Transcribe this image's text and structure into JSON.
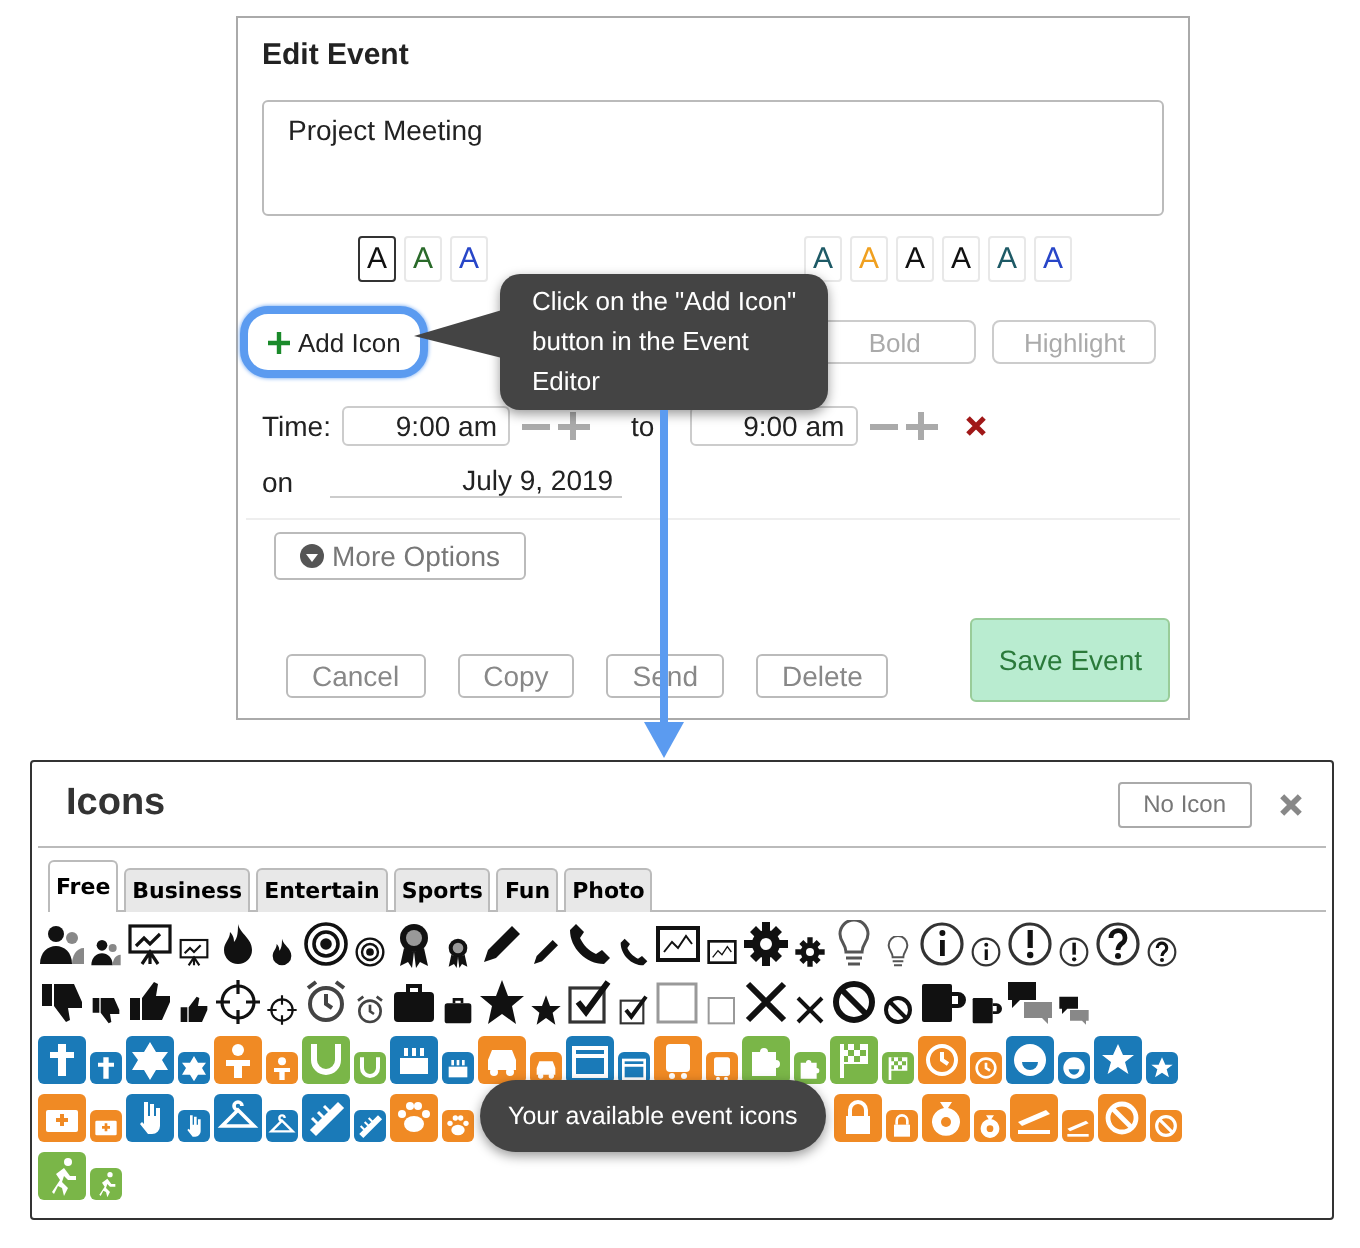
{
  "editor": {
    "title": "Edit Event",
    "description": "Project Meeting",
    "swatches": [
      {
        "letter": "A",
        "color": "#111111",
        "selected": true
      },
      {
        "letter": "A",
        "color": "#2a6a2a",
        "selected": false
      },
      {
        "letter": "A",
        "color": "#2846c8",
        "selected": false
      },
      {
        "letter": "A",
        "color": "#1e5a66",
        "selected": false
      },
      {
        "letter": "A",
        "color": "#f0a020",
        "selected": false
      },
      {
        "letter": "A",
        "color": "#111111",
        "selected": false
      },
      {
        "letter": "A",
        "color": "#111111",
        "selected": false
      },
      {
        "letter": "A",
        "color": "#1e5a66",
        "selected": false
      },
      {
        "letter": "A",
        "color": "#2846c8",
        "selected": false
      }
    ],
    "tool_buttons": [
      {
        "label": "Add Icon",
        "kind": "add",
        "highlighted": true
      },
      {
        "label": "Bold",
        "kind": "plain",
        "highlighted": false
      },
      {
        "label": "Highlight",
        "kind": "plain",
        "highlighted": false
      }
    ],
    "time": {
      "label": "Time:",
      "start": "9:00 am",
      "separator": "to",
      "end": "9:00 am"
    },
    "date": {
      "label": "on",
      "value": "July 9, 2019"
    },
    "more_options": "More Options",
    "actions": [
      "Cancel",
      "Copy",
      "Send",
      "Delete"
    ],
    "save": "Save Event"
  },
  "callouts": [
    "Click on the \"Add Icon\" button in the Event Editor",
    "Your available event icons"
  ],
  "icons_dialog": {
    "title": "Icons",
    "no_icon": "No Icon",
    "tabs": [
      {
        "label": "Free",
        "selected": true
      },
      {
        "label": "Business",
        "selected": false
      },
      {
        "label": "Entertain",
        "selected": false
      },
      {
        "label": "Sports",
        "selected": false
      },
      {
        "label": "Fun",
        "selected": false
      },
      {
        "label": "Photo",
        "selected": false
      }
    ]
  }
}
